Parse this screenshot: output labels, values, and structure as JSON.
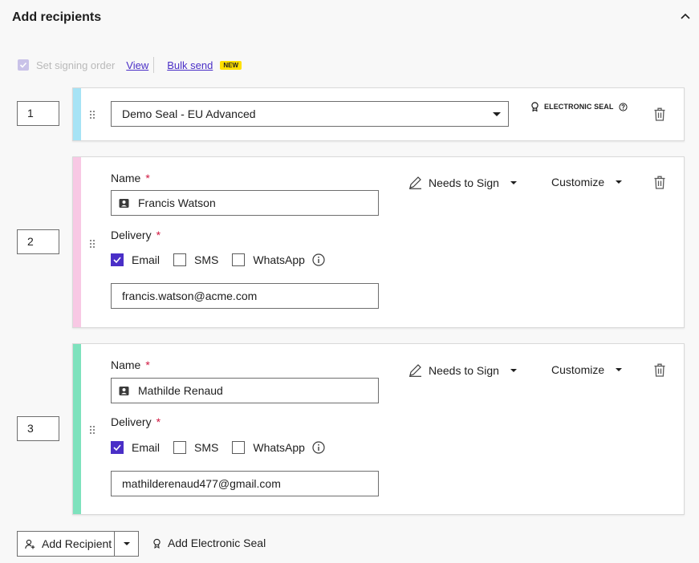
{
  "header": {
    "title": "Add recipients"
  },
  "options": {
    "signing_order_label": "Set signing order",
    "view_link": "View",
    "bulk_send_link": "Bulk send",
    "new_badge": "NEW"
  },
  "recipients": [
    {
      "order": "1",
      "type": "seal",
      "strip_color": "#a6e3f5",
      "seal_select_value": "Demo Seal - EU Advanced",
      "seal_tag": "ELECTRONIC SEAL"
    },
    {
      "order": "2",
      "type": "signer",
      "strip_color": "#f8c8e4",
      "name_label": "Name",
      "name_value": "Francis Watson",
      "delivery_label": "Delivery",
      "delivery_options": [
        {
          "label": "Email",
          "checked": true
        },
        {
          "label": "SMS",
          "checked": false
        },
        {
          "label": "WhatsApp",
          "checked": false
        }
      ],
      "email_value": "francis.watson@acme.com",
      "role": "Needs to Sign",
      "customize": "Customize"
    },
    {
      "order": "3",
      "type": "signer",
      "strip_color": "#7ee2bd",
      "name_label": "Name",
      "name_value": "Mathilde Renaud",
      "delivery_label": "Delivery",
      "delivery_options": [
        {
          "label": "Email",
          "checked": true
        },
        {
          "label": "SMS",
          "checked": false
        },
        {
          "label": "WhatsApp",
          "checked": false
        }
      ],
      "email_value": "mathilderenaud477@gmail.com",
      "role": "Needs to Sign",
      "customize": "Customize"
    }
  ],
  "footer": {
    "add_recipient": "Add Recipient",
    "add_seal": "Add Electronic Seal"
  },
  "colors": {
    "accent": "#4a2fc7",
    "required": "#d0163f",
    "new_badge_bg": "#ffe000"
  }
}
